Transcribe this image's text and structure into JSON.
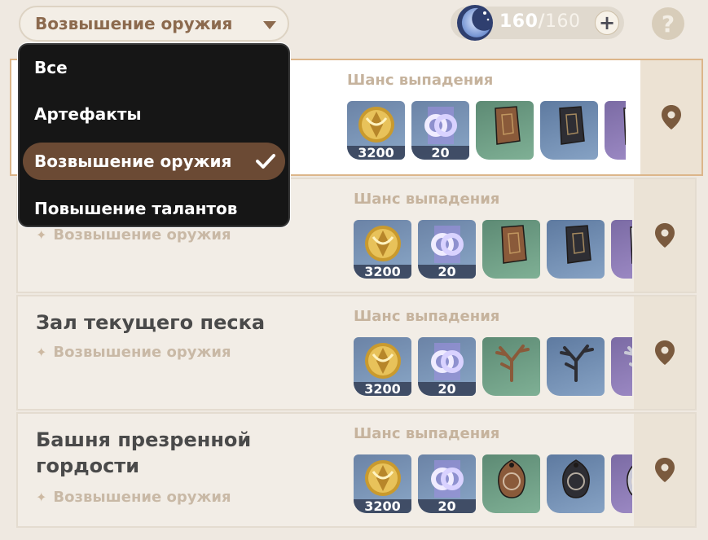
{
  "header": {
    "filter_selected": "Возвышение оружия",
    "resin_current": "160",
    "resin_separator": "/",
    "resin_max": "160",
    "resin_add_label": "+",
    "help_label": "?"
  },
  "dropdown": {
    "options": [
      "Все",
      "Артефакты",
      "Возвышение оружия",
      "Повышение талантов"
    ],
    "selected_index": 2
  },
  "drop_label": "Шанс выпадения",
  "domains": [
    {
      "name": "",
      "category": "",
      "items": [
        {
          "icon": "mora-icon",
          "qty": "3200",
          "bg": "blue"
        },
        {
          "icon": "adventure-exp-icon",
          "qty": "20",
          "bg": "blue"
        },
        {
          "icon": "weapon-material-green-icon",
          "qty": "",
          "bg": "green"
        },
        {
          "icon": "weapon-material-blue-icon",
          "qty": "",
          "bg": "blue2"
        },
        {
          "icon": "weapon-material-purple-icon",
          "qty": "",
          "bg": "purple"
        }
      ]
    },
    {
      "name": "",
      "category": "Возвышение оружия",
      "items": [
        {
          "icon": "mora-icon",
          "qty": "3200",
          "bg": "blue"
        },
        {
          "icon": "adventure-exp-icon",
          "qty": "20",
          "bg": "blue"
        },
        {
          "icon": "weapon-material-green-icon",
          "qty": "",
          "bg": "green"
        },
        {
          "icon": "weapon-material-blue-icon",
          "qty": "",
          "bg": "blue2"
        },
        {
          "icon": "weapon-material-purple-icon",
          "qty": "",
          "bg": "purple"
        }
      ]
    },
    {
      "name": "Зал текущего песка",
      "category": "Возвышение оружия",
      "items": [
        {
          "icon": "mora-icon",
          "qty": "3200",
          "bg": "blue"
        },
        {
          "icon": "adventure-exp-icon",
          "qty": "20",
          "bg": "blue"
        },
        {
          "icon": "branch-material-green-icon",
          "qty": "",
          "bg": "green"
        },
        {
          "icon": "branch-material-blue-icon",
          "qty": "",
          "bg": "blue2"
        },
        {
          "icon": "branch-material-purple-icon",
          "qty": "",
          "bg": "purple"
        }
      ]
    },
    {
      "name": "Башня презренной гордости",
      "category": "Возвышение оружия",
      "items": [
        {
          "icon": "mora-icon",
          "qty": "3200",
          "bg": "blue"
        },
        {
          "icon": "adventure-exp-icon",
          "qty": "20",
          "bg": "blue"
        },
        {
          "icon": "pendant-material-green-icon",
          "qty": "",
          "bg": "green"
        },
        {
          "icon": "pendant-material-blue-icon",
          "qty": "",
          "bg": "blue2"
        },
        {
          "icon": "pendant-material-purple-icon",
          "qty": "",
          "bg": "purple"
        }
      ]
    }
  ],
  "colors": {
    "accent_brown": "#8c6a4e",
    "selected_bg": "#6b4a34",
    "active_border": "#dcb68a",
    "pin": "#7a5a3e"
  }
}
